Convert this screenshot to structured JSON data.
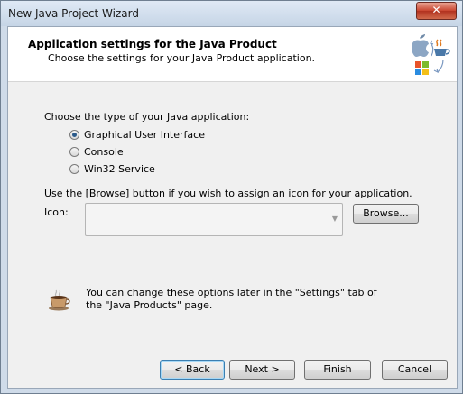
{
  "window": {
    "title": "New Java Project Wizard",
    "close_glyph": "✕"
  },
  "header": {
    "title": "Application settings for the Java Product",
    "subtitle": "Choose the settings for your Java Product application."
  },
  "app_type": {
    "label": "Choose the type of your Java application:",
    "options": [
      {
        "label": "Graphical User Interface",
        "selected": true
      },
      {
        "label": "Console",
        "selected": false
      },
      {
        "label": "Win32 Service",
        "selected": false
      }
    ]
  },
  "icon": {
    "hint": "Use the [Browse] button if you wish to assign an icon for your application.",
    "label": "Icon:",
    "value": "",
    "browse_label": "Browse..."
  },
  "note": {
    "text": "You can change these options later in the \"Settings\" tab of the \"Java Products\" page."
  },
  "buttons": {
    "back": "< Back",
    "next": "Next >",
    "finish": "Finish",
    "cancel": "Cancel"
  },
  "icons": {
    "logo": "java-platform-logo-icon",
    "note": "coffee-cup-icon",
    "dropdown": "dropdown-arrow-icon"
  },
  "colors": {
    "accent": "#3c7fb1",
    "close": "#c9452f"
  }
}
